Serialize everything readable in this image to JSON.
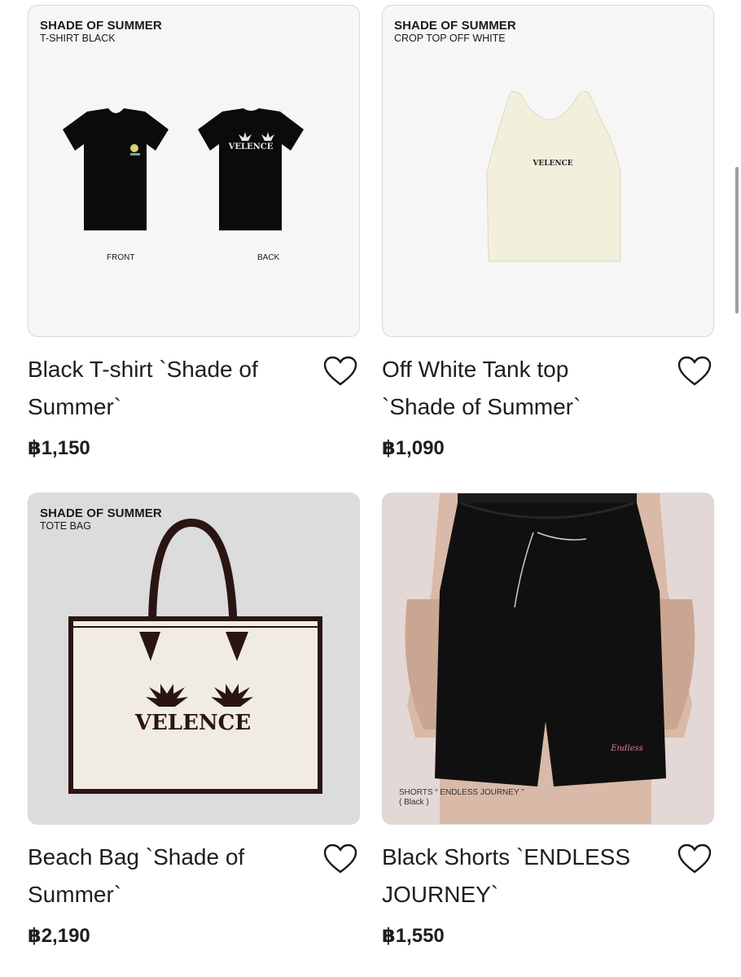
{
  "products": [
    {
      "image": {
        "tag_title": "SHADE OF SUMMER",
        "tag_sub": "T-SHIRT BLACK",
        "front_label": "FRONT",
        "back_label": "BACK"
      },
      "title_line1": "Black T-shirt `Shade of",
      "title_line2": "Summer`",
      "price": "฿1,150"
    },
    {
      "image": {
        "tag_title": "SHADE OF SUMMER",
        "tag_sub": "CROP TOP OFF WHITE"
      },
      "title_line1": "Off White Tank top",
      "title_line2": "`Shade of Summer`",
      "price": "฿1,090"
    },
    {
      "image": {
        "tag_title": "SHADE OF SUMMER",
        "tag_sub": "TOTE BAG",
        "brand_text": "VELENCE"
      },
      "title_line1": "Beach Bag `Shade of",
      "title_line2": "Summer`",
      "price": "฿2,190"
    },
    {
      "image": {
        "caption_line1": "SHORTS “ ENDLESS JOURNEY ”",
        "caption_line2": "( Black )"
      },
      "title_line1": "Black Shorts `ENDLESS",
      "title_line2": "JOURNEY`",
      "price": "฿1,550"
    }
  ],
  "icons": {
    "favorite": "heart-outline-icon"
  },
  "colors": {
    "text": "#1e1e1e",
    "card_border": "#d9d9d9",
    "image_bg": "#f6f6f6"
  }
}
